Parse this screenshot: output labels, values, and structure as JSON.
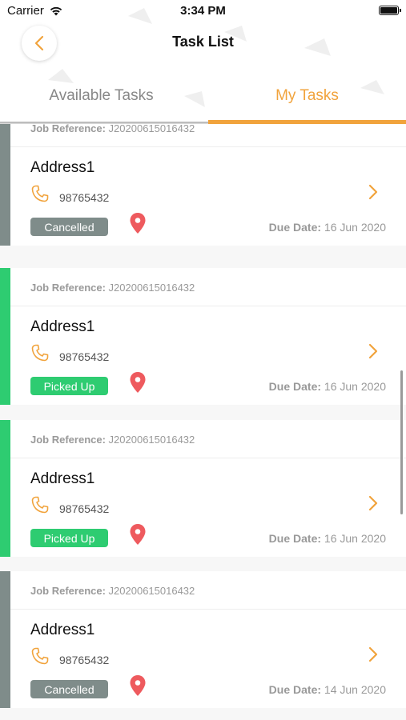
{
  "status_bar": {
    "carrier": "Carrier",
    "time": "3:34 PM"
  },
  "nav": {
    "title": "Task List"
  },
  "tabs": [
    {
      "label": "Available Tasks",
      "active": false
    },
    {
      "label": "My Tasks",
      "active": true
    }
  ],
  "colors": {
    "accent": "#f1a33c",
    "cancelled": "#7f8c8a",
    "picked_up": "#2ecc71",
    "pin": "#ee5a5e"
  },
  "tasks": [
    {
      "ref_label": "Job Reference:",
      "ref": "J20200615016432",
      "address": "Address1",
      "phone": "98765432",
      "status": "Cancelled",
      "due_label": "Due Date:",
      "due": "16 Jun 2020"
    },
    {
      "ref_label": "Job Reference:",
      "ref": "J20200615016432",
      "address": "Address1",
      "phone": "98765432",
      "status": "Picked Up",
      "due_label": "Due Date:",
      "due": "16 Jun 2020"
    },
    {
      "ref_label": "Job Reference:",
      "ref": "J20200615016432",
      "address": "Address1",
      "phone": "98765432",
      "status": "Picked Up",
      "due_label": "Due Date:",
      "due": "16 Jun 2020"
    },
    {
      "ref_label": "Job Reference:",
      "ref": "J20200615016432",
      "address": "Address1",
      "phone": "98765432",
      "status": "Cancelled",
      "due_label": "Due Date:",
      "due": "14 Jun 2020"
    }
  ]
}
